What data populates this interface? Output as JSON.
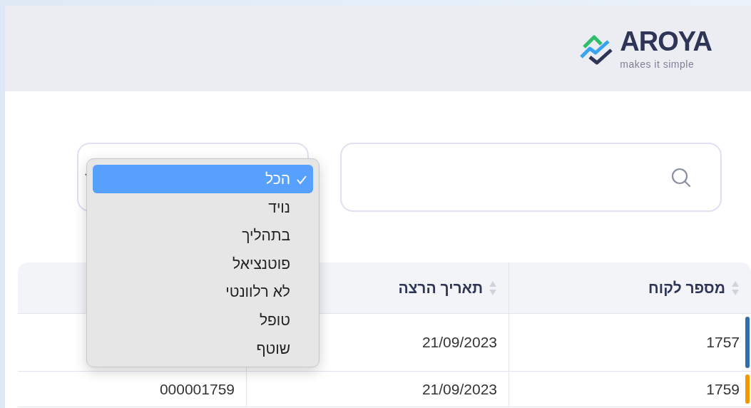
{
  "header": {
    "logo": {
      "name": "AROYA",
      "tagline": "makes it simple"
    }
  },
  "status_filter": {
    "expanded": true,
    "options": [
      {
        "label": "הכל",
        "selected": true
      },
      {
        "label": "נויד",
        "selected": false
      },
      {
        "label": "בתהליך",
        "selected": false
      },
      {
        "label": "פוטנציאל",
        "selected": false
      },
      {
        "label": "לא רלוונטי",
        "selected": false
      },
      {
        "label": "טופל",
        "selected": false
      },
      {
        "label": "שוטף",
        "selected": false
      }
    ]
  },
  "table": {
    "columns": [
      {
        "label": "מספר לקוח"
      },
      {
        "label": "תאריך הרצה"
      }
    ],
    "rows": [
      {
        "color": "#2f6ea8",
        "cells": [
          "1757",
          "21/09/2023"
        ]
      },
      {
        "color": "#f09a00",
        "cells": [
          "1759",
          "21/09/2023",
          "000001759"
        ]
      }
    ]
  }
}
